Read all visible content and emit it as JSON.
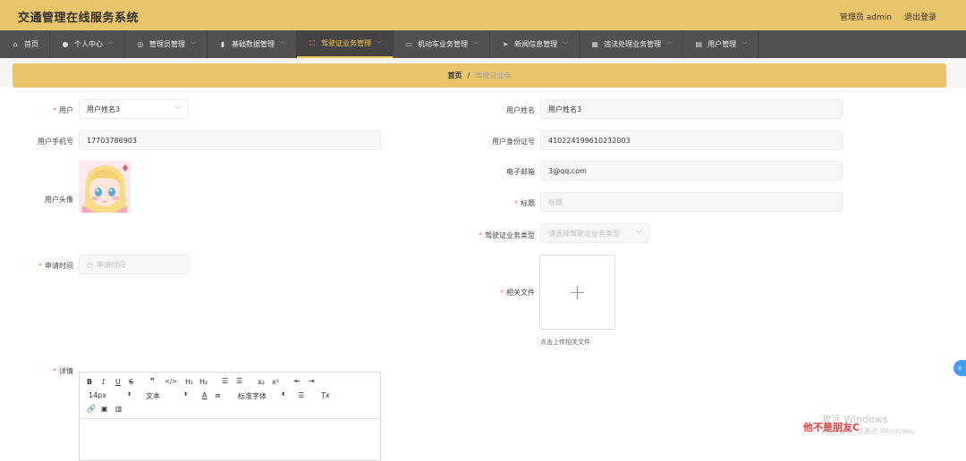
{
  "header": {
    "title": "交通管理在线服务系统",
    "user_label": "管理员 admin",
    "logout_label": "退出登录"
  },
  "nav": [
    {
      "label": "首页",
      "icon": "home-icon",
      "glyph": "⌂",
      "caret": false,
      "active": false
    },
    {
      "label": "个人中心",
      "icon": "user-icon",
      "glyph": "●",
      "caret": true,
      "active": false
    },
    {
      "label": "管理员管理",
      "icon": "globe-icon",
      "glyph": "◎",
      "caret": true,
      "active": false
    },
    {
      "label": "基础数据管理",
      "icon": "bar-chart-icon",
      "glyph": "▮",
      "caret": true,
      "active": false
    },
    {
      "label": "驾驶证业务管理",
      "icon": "fullscreen-icon",
      "glyph": "⛶",
      "caret": true,
      "active": true
    },
    {
      "label": "机动车业务管理",
      "icon": "monitor-icon",
      "glyph": "▭",
      "caret": true,
      "active": false
    },
    {
      "label": "新闻信息管理",
      "icon": "send-icon",
      "glyph": "➤",
      "caret": true,
      "active": false
    },
    {
      "label": "违法处理业务管理",
      "icon": "grid-icon",
      "glyph": "▦",
      "caret": true,
      "active": false
    },
    {
      "label": "用户管理",
      "icon": "document-icon",
      "glyph": "▤",
      "caret": true,
      "active": false
    }
  ],
  "breadcrumb": {
    "home": "首页",
    "sep": "/",
    "current": "驾驶证业务"
  },
  "form": {
    "user_label": "用户",
    "user_value": "用户姓名3",
    "username_label": "用户姓名",
    "username_value": "用户姓名3",
    "phone_label": "用户手机号",
    "phone_value": "17703786903",
    "idcard_label": "用户身份证号",
    "idcard_value": "410224199610232003",
    "email_label": "电子邮箱",
    "email_value": "3@qq.com",
    "avatar_label": "用户头像",
    "title_label": "标题",
    "title_placeholder": "标题",
    "type_label": "驾驶证业务类型",
    "type_placeholder": "请选择驾驶证业务类型",
    "time_label": "申请时间",
    "time_placeholder": "申请时间",
    "files_label": "相关文件",
    "upload_hint": "点击上传相关文件",
    "detail_label": "详情"
  },
  "editor": {
    "font_size": "14px",
    "block_type": "文本",
    "font_family": "标准字体",
    "b": "B",
    "i": "I",
    "u": "U",
    "s": "S",
    "quote": "❞",
    "code": "</>",
    "h1": "H₁",
    "h2": "H₂",
    "sub": "x₂",
    "sup": "x²"
  },
  "watermark": {
    "line1": "激活 Windows",
    "line2": "转到\"设置\"以激活 Windows。",
    "overlay": "他不是朋友C"
  },
  "side_tab": "‹",
  "colors": {
    "header_bg": "#e8c56a",
    "nav_bg": "#515151",
    "accent": "#f3c654",
    "required": "#f56c6c"
  }
}
